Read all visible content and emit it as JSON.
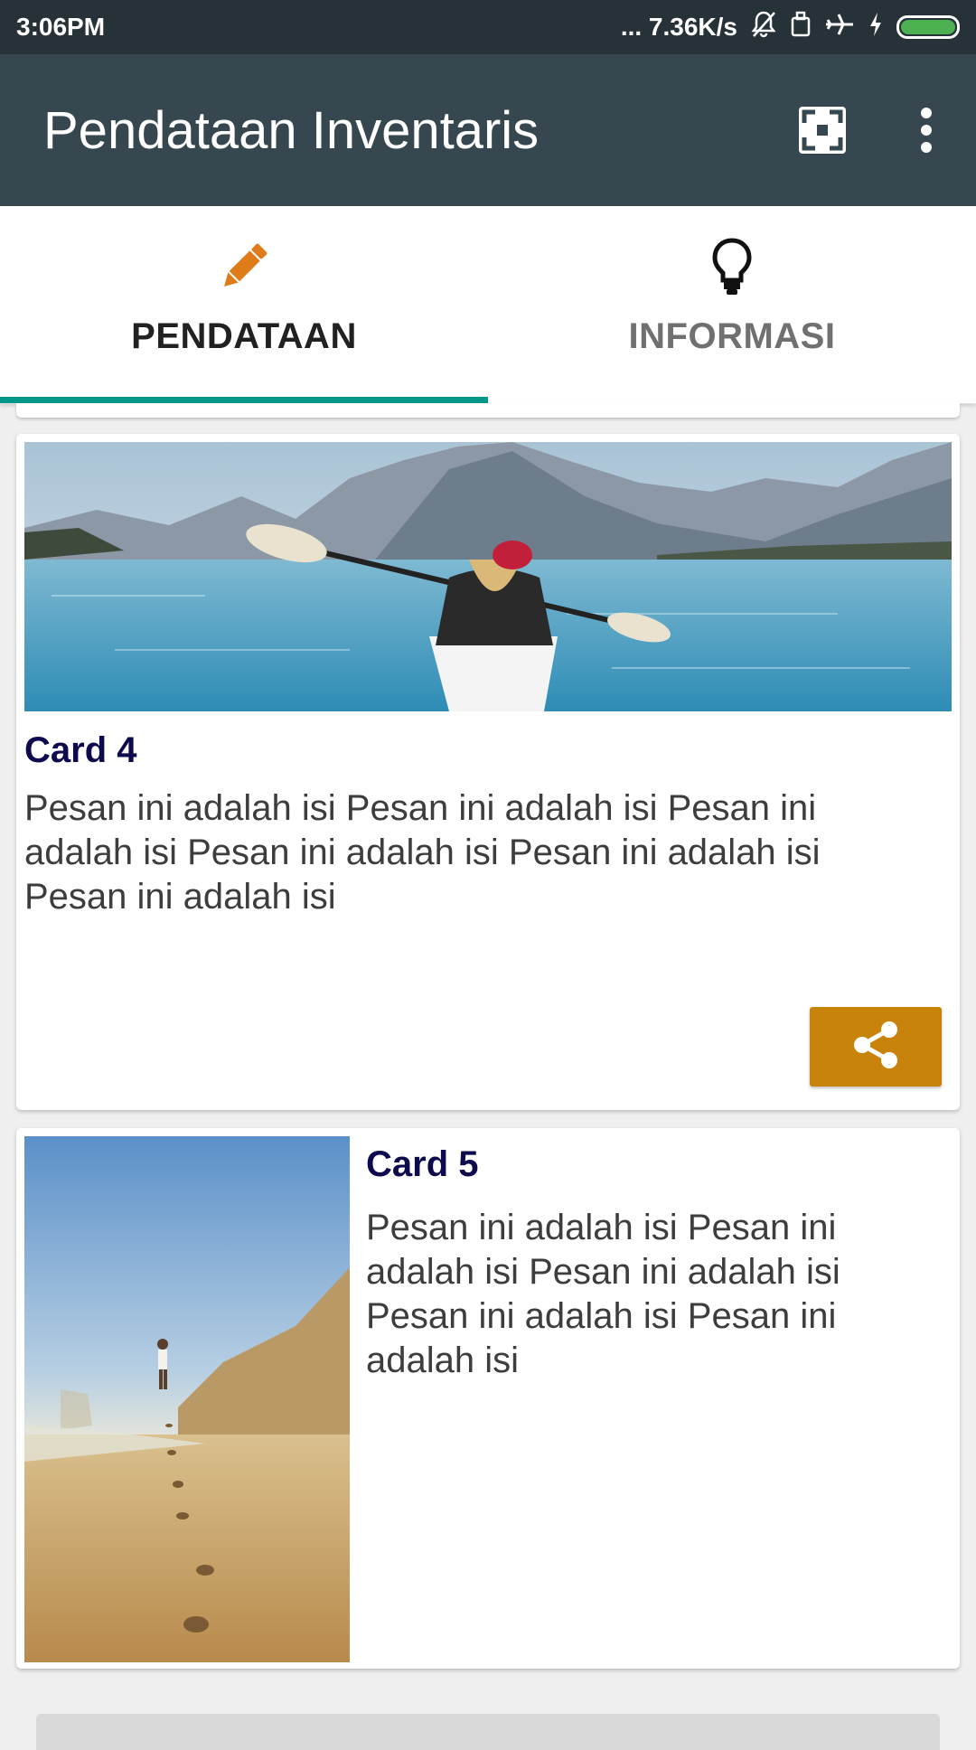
{
  "status_bar": {
    "time": "3:06PM",
    "network_speed": "... 7.36K/s",
    "icons": [
      "mute-bell-icon",
      "sim-icon",
      "airplane-icon",
      "charging-icon",
      "battery-icon"
    ]
  },
  "app_bar": {
    "title": "Pendataan Inventaris",
    "actions": [
      "fullscreen-icon",
      "more-vert-icon"
    ]
  },
  "tabs": [
    {
      "label": "PENDATAAN",
      "icon": "pencil-icon",
      "active": true,
      "icon_color": "#e07b1a"
    },
    {
      "label": "INFORMASI",
      "icon": "lightbulb-icon",
      "active": false,
      "icon_color": "#111111"
    }
  ],
  "cards": [
    {
      "title": "Card 4",
      "body": "Pesan ini adalah isi Pesan ini adalah isi Pesan ini adalah isi Pesan ini adalah isi Pesan ini adalah isi Pesan ini adalah isi",
      "image": "kayak-lake-mountains",
      "action": "share-icon"
    },
    {
      "title": "Card 5",
      "body": "Pesan ini adalah isi Pesan ini adalah isi Pesan ini adalah isi Pesan ini adalah isi Pesan ini adalah isi",
      "image": "beach-footprints"
    }
  ],
  "colors": {
    "status_bar": "#263238",
    "app_bar": "#37474f",
    "tab_indicator": "#009688",
    "card_title": "#0d0a4e",
    "share_button": "#c8830a"
  }
}
